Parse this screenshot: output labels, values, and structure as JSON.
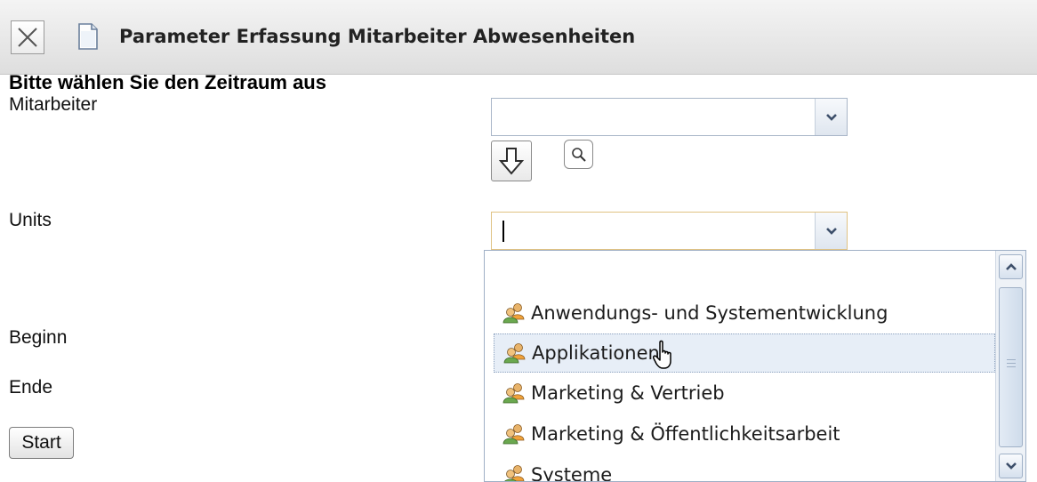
{
  "window": {
    "title": "Parameter Erfassung Mitarbeiter Abwesenheiten",
    "close_icon": "close-x-icon",
    "document_icon": "document-icon"
  },
  "form": {
    "heading": "Bitte wählen Sie den Zeitraum aus",
    "fields": {
      "mitarbeiter_label": "Mitarbeiter",
      "mitarbeiter_value": "",
      "units_label": "Units",
      "units_value": "",
      "beginn_label": "Beginn",
      "ende_label": "Ende"
    },
    "start_label": "Start"
  },
  "units_dropdown": {
    "open": true,
    "hovered_index": 1,
    "items": [
      {
        "label": "Anwendungs- und Systementwicklung",
        "icon": "group-users-icon"
      },
      {
        "label": "Applikationen",
        "icon": "group-users-icon"
      },
      {
        "label": "Marketing & Vertrieb",
        "icon": "group-users-icon"
      },
      {
        "label": "Marketing & Öffentlichkeitsarbeit",
        "icon": "group-users-icon"
      },
      {
        "label": "Systeme",
        "icon": "group-users-icon"
      }
    ]
  },
  "colors": {
    "focus_border": "#e0c283",
    "combo_border": "#a9b6c8",
    "hover_bg": "#e7eef7"
  }
}
